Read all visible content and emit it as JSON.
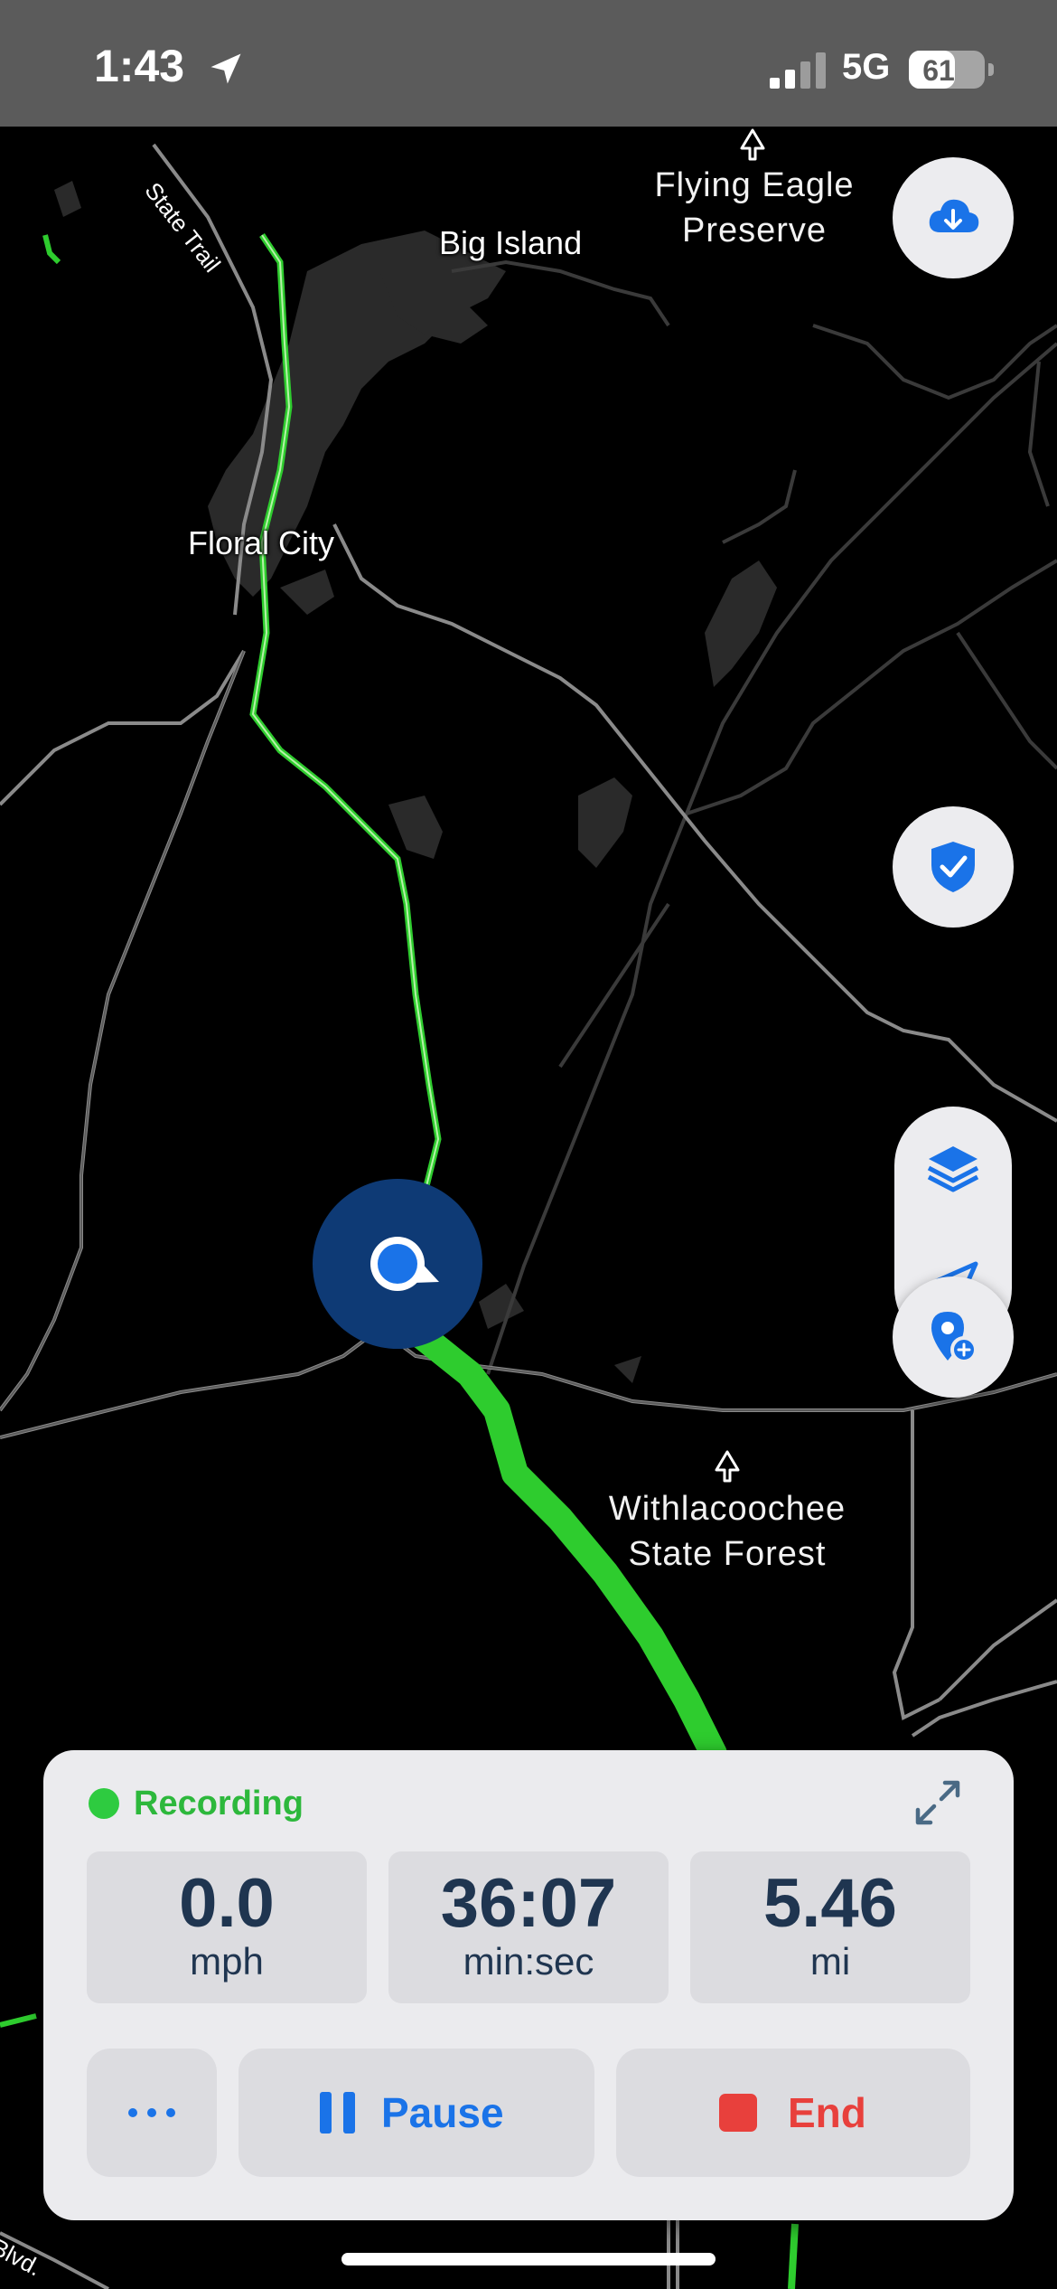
{
  "status_bar": {
    "time": "1:43",
    "network": "5G",
    "battery_level": "61",
    "battery_fraction": 0.61,
    "signal_bars_active": 2,
    "signal_bars_total": 4,
    "icons": [
      "location-arrow-icon",
      "signal-icon",
      "battery-icon"
    ]
  },
  "map": {
    "theme": "dark",
    "labels": {
      "flying_eagle_line1": "Flying Eagle",
      "flying_eagle_line2": "Preserve",
      "big_island": "Big Island",
      "floral_city": "Floral City",
      "withlacoochee_line1": "Withlacoochee",
      "withlacoochee_line2": "State Forest",
      "state_trail": "State Trail",
      "blvd": "Blvd."
    },
    "colors": {
      "route": "#2ecc2e",
      "roads": "#8a8a8a",
      "water": "#2a2a2a",
      "user_location": "#1a73e8",
      "accuracy_halo": "#0e3a75"
    }
  },
  "map_controls": {
    "download_button_icon": "cloud-download-icon",
    "safety_button_icon": "shield-check-icon",
    "layers_button_icon": "layers-icon",
    "locate_button_icon": "navigation-arrow-icon",
    "add_pin_button_icon": "add-location-pin-icon",
    "accent": "#1a73e8"
  },
  "recording_panel": {
    "status": "Recording",
    "status_color": "#2ecb40",
    "expand_icon": "expand-arrows-icon",
    "stats": [
      {
        "value": "0.0",
        "unit": "mph"
      },
      {
        "value": "36:07",
        "unit": "min:sec"
      },
      {
        "value": "5.46",
        "unit": "mi"
      }
    ],
    "actions": {
      "more_icon": "more-dots-icon",
      "pause_label": "Pause",
      "pause_icon": "pause-icon",
      "end_label": "End",
      "end_icon": "stop-icon",
      "pause_color": "#1a73e8",
      "end_color": "#e8403c"
    }
  }
}
